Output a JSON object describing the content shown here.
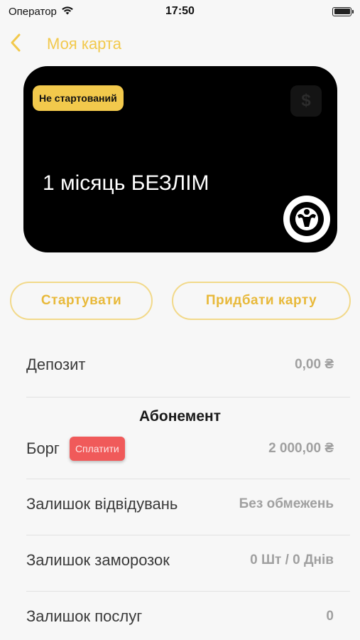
{
  "status_bar": {
    "carrier": "Оператор",
    "time": "17:50"
  },
  "nav": {
    "title": "Моя карта"
  },
  "card": {
    "badge": "Не стартований",
    "coin_symbol": "$",
    "title": "1 місяць БЕЗЛІМ"
  },
  "actions": {
    "start_label": "Стартувати",
    "buy_label": "Придбати карту"
  },
  "deposit": {
    "label": "Депозит",
    "value": "0,00 ₴"
  },
  "subscription": {
    "section_title": "Абонемент",
    "debt_label": "Борг",
    "pay_label": "Сплатити",
    "debt_value": "2 000,00 ₴",
    "visits_label": "Залишок відвідувань",
    "visits_value": "Без обмежень",
    "freezes_label": "Залишок заморозок",
    "freezes_value": "0 Шт / 0 Днів",
    "services_label": "Залишок послуг",
    "services_value": "0"
  },
  "colors": {
    "accent": "#f2c94c",
    "card_bg": "#000000",
    "pay_button": "#f05a5a",
    "background": "#f7f7f7"
  }
}
